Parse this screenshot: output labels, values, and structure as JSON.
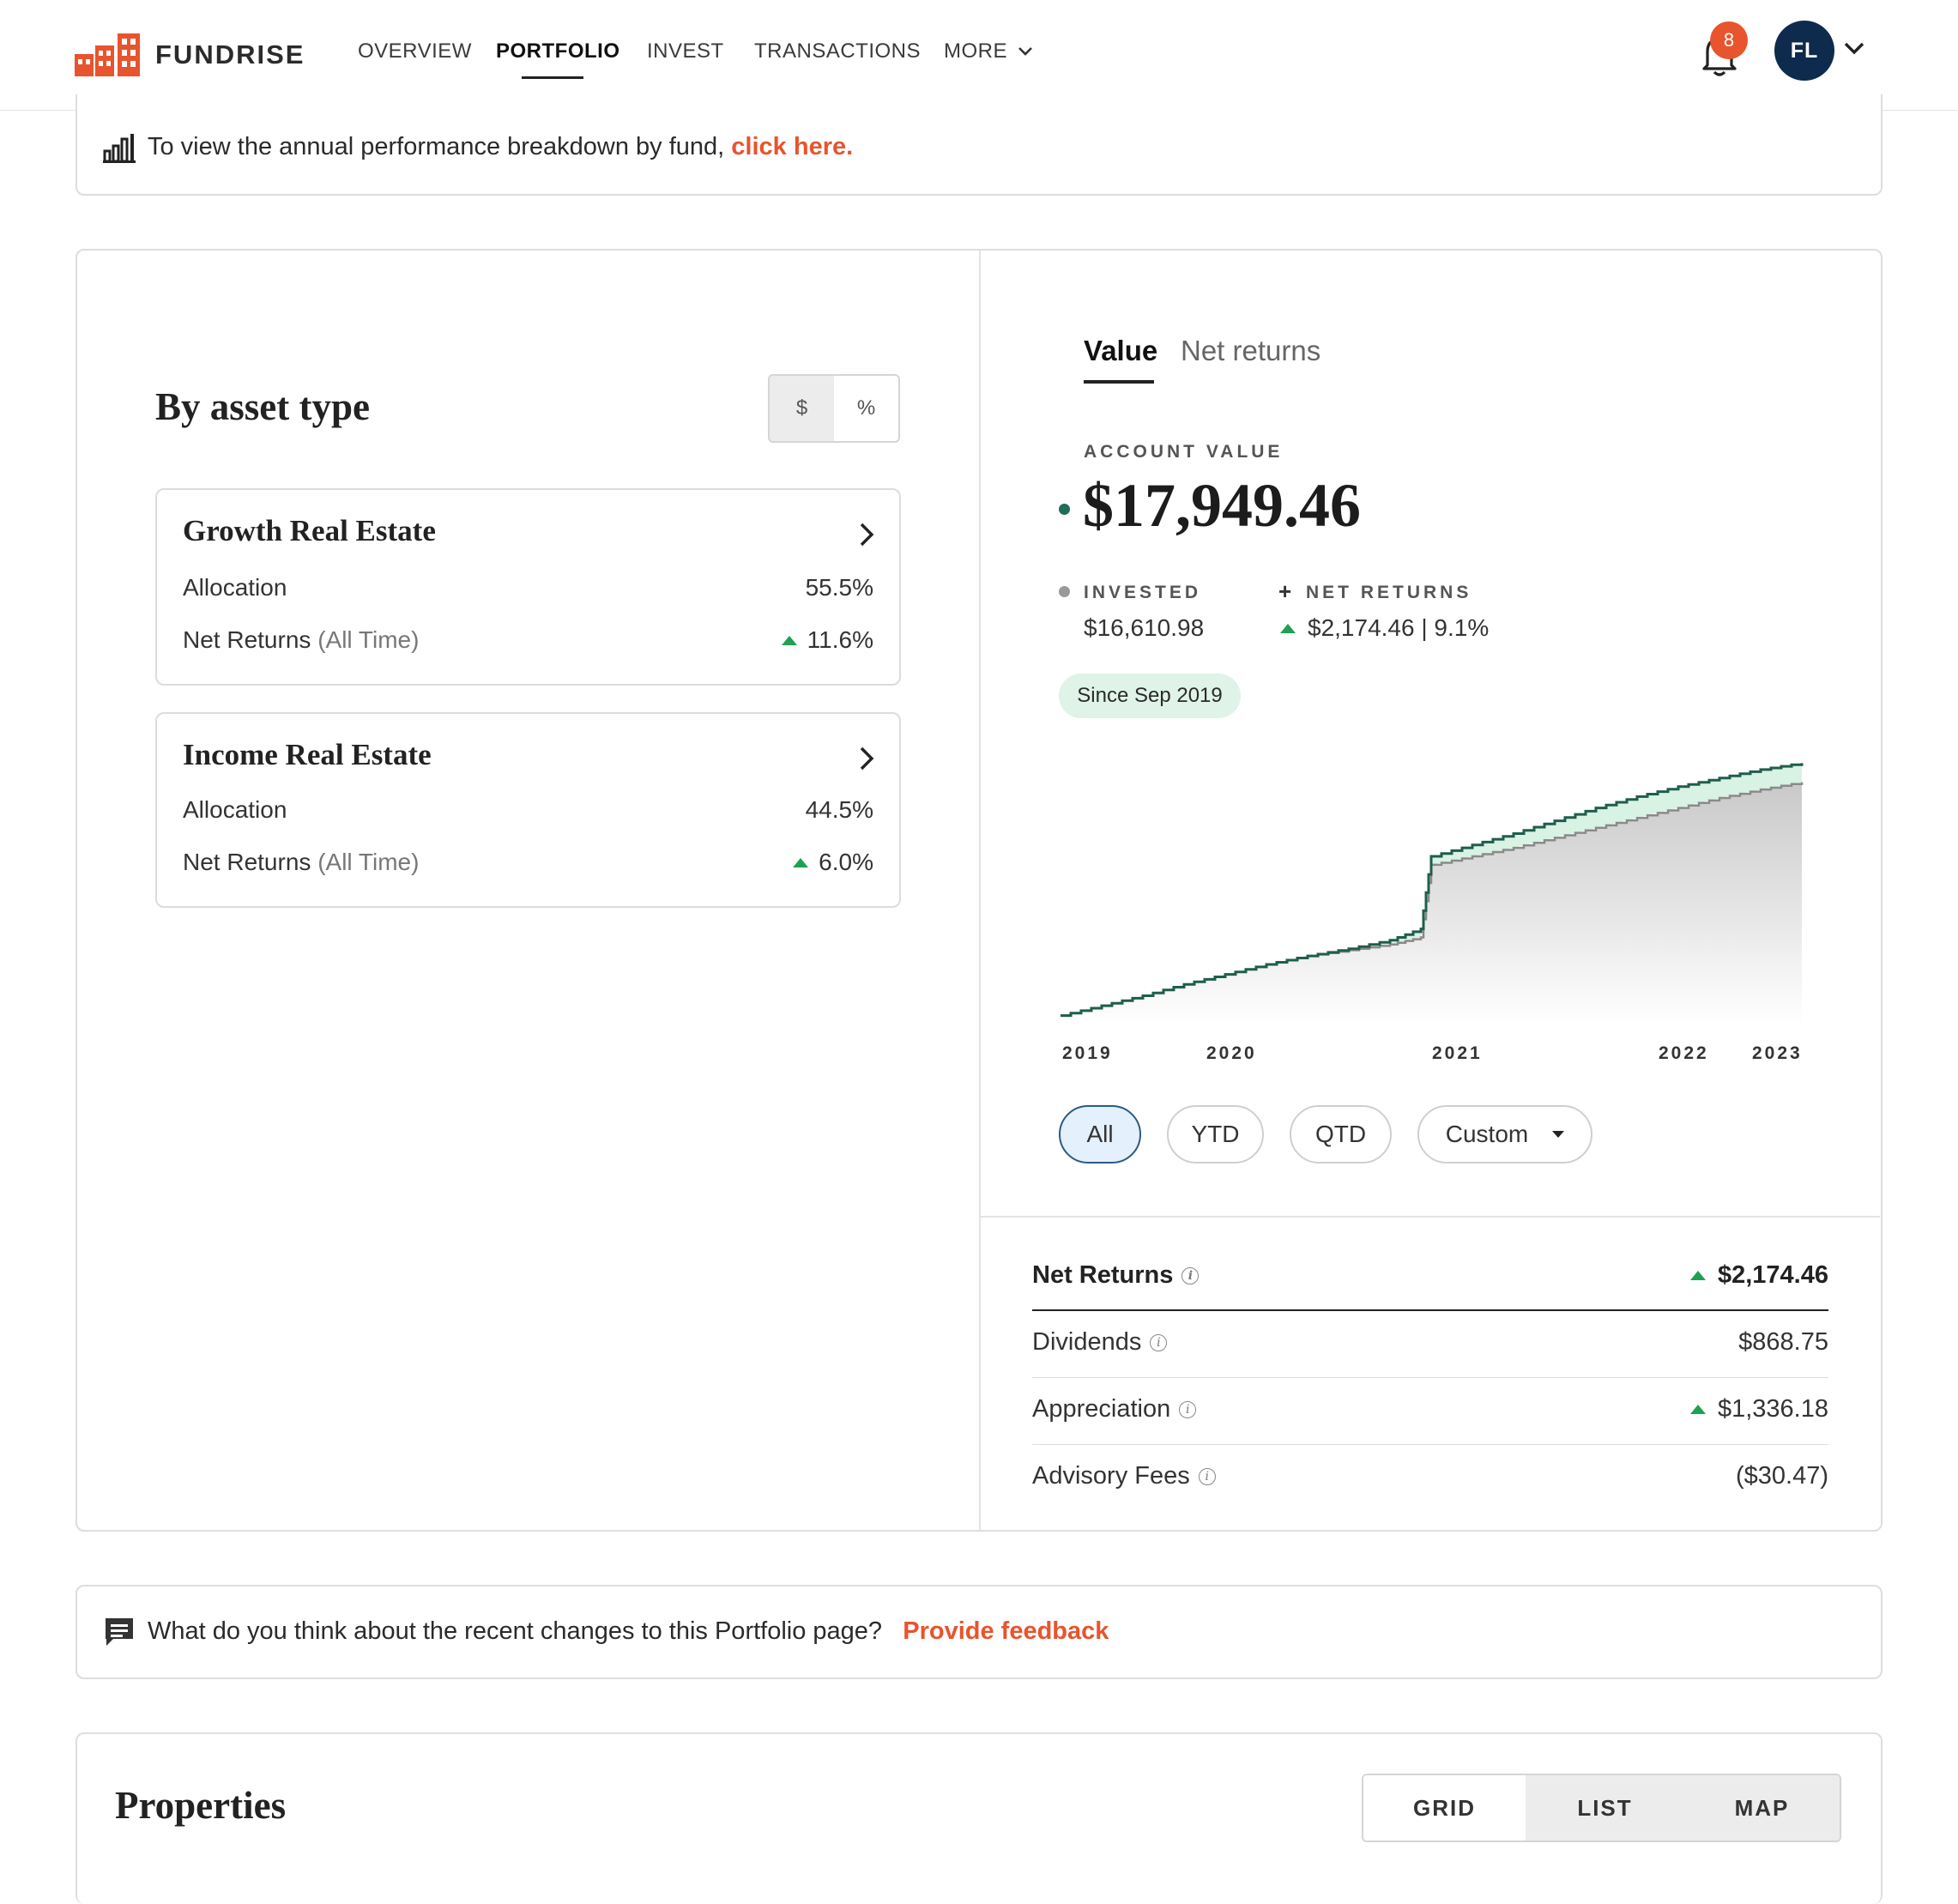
{
  "header": {
    "brand": "FUNDRISE",
    "nav": [
      {
        "label": "OVERVIEW"
      },
      {
        "label": "PORTFOLIO"
      },
      {
        "label": "INVEST"
      },
      {
        "label": "TRANSACTIONS"
      },
      {
        "label": "MORE"
      }
    ],
    "notification_count": "8",
    "avatar_initials": "FL"
  },
  "banner": {
    "text": "To view the annual performance breakdown by fund, ",
    "link": "click here."
  },
  "asset_type": {
    "title": "By asset type",
    "toggle": [
      "$",
      "%"
    ],
    "cards": [
      {
        "title": "Growth Real Estate",
        "allocation_label": "Allocation",
        "allocation": "55.5%",
        "returns_label": "Net Returns",
        "returns_suffix": "(All Time)",
        "returns": "11.6%"
      },
      {
        "title": "Income Real Estate",
        "allocation_label": "Allocation",
        "allocation": "44.5%",
        "returns_label": "Net Returns",
        "returns_suffix": "(All Time)",
        "returns": "6.0%"
      }
    ]
  },
  "performance": {
    "tabs": [
      "Value",
      "Net returns"
    ],
    "account_value_label": "ACCOUNT VALUE",
    "account_value": "$17,949.46",
    "invested_label": "INVESTED",
    "invested": "$16,610.98",
    "net_returns_label": "NET RETURNS",
    "net_returns": "$2,174.46 | 9.1%",
    "since": "Since Sep 2019",
    "ranges": [
      "All",
      "YTD",
      "QTD",
      "Custom"
    ],
    "colors": {
      "value_line": "#1e5e4d",
      "fill_returns": "#d8f2e3",
      "invested_line": "#8a8a8a"
    }
  },
  "chart_data": {
    "type": "area",
    "title": "",
    "xlabel": "",
    "ylabel": "",
    "x_tick_labels": [
      "2019",
      "2020",
      "2021",
      "2022",
      "2023"
    ],
    "x": [
      2019.7,
      2019.9,
      2020.1,
      2020.3,
      2020.5,
      2020.7,
      2020.9,
      2021.1,
      2021.3,
      2021.45,
      2021.5,
      2021.7,
      2021.9,
      2022.1,
      2022.3,
      2022.5,
      2022.7,
      2022.9,
      2023.1,
      2023.3
    ],
    "series": [
      {
        "name": "",
        "values": [
          200,
          900,
          1600,
          2400,
          3100,
          3800,
          4400,
          4900,
          5500,
          6300,
          11400,
          12200,
          13000,
          13900,
          14800,
          15600,
          16300,
          16900,
          17500,
          17949
        ]
      },
      {
        "name": "",
        "values": [
          200,
          900,
          1600,
          2400,
          3100,
          3800,
          4400,
          4800,
          5200,
          5700,
          10800,
          11400,
          12000,
          12700,
          13400,
          14100,
          14800,
          15500,
          16100,
          16611
        ]
      }
    ],
    "ylim": [
      0,
      19000
    ],
    "grid": false
  },
  "stats": [
    {
      "label": "Net Returns",
      "value": "$2,174.46",
      "arrow": true
    },
    {
      "label": "Dividends",
      "value": "$868.75",
      "arrow": false
    },
    {
      "label": "Appreciation",
      "value": "$1,336.18",
      "arrow": true
    },
    {
      "label": "Advisory Fees",
      "value": "($30.47)",
      "arrow": false
    }
  ],
  "feedback": {
    "text": "What do you think about the recent changes to this Portfolio page?",
    "link": "Provide feedback"
  },
  "properties": {
    "title": "Properties",
    "views": [
      "GRID",
      "LIST",
      "MAP"
    ]
  }
}
